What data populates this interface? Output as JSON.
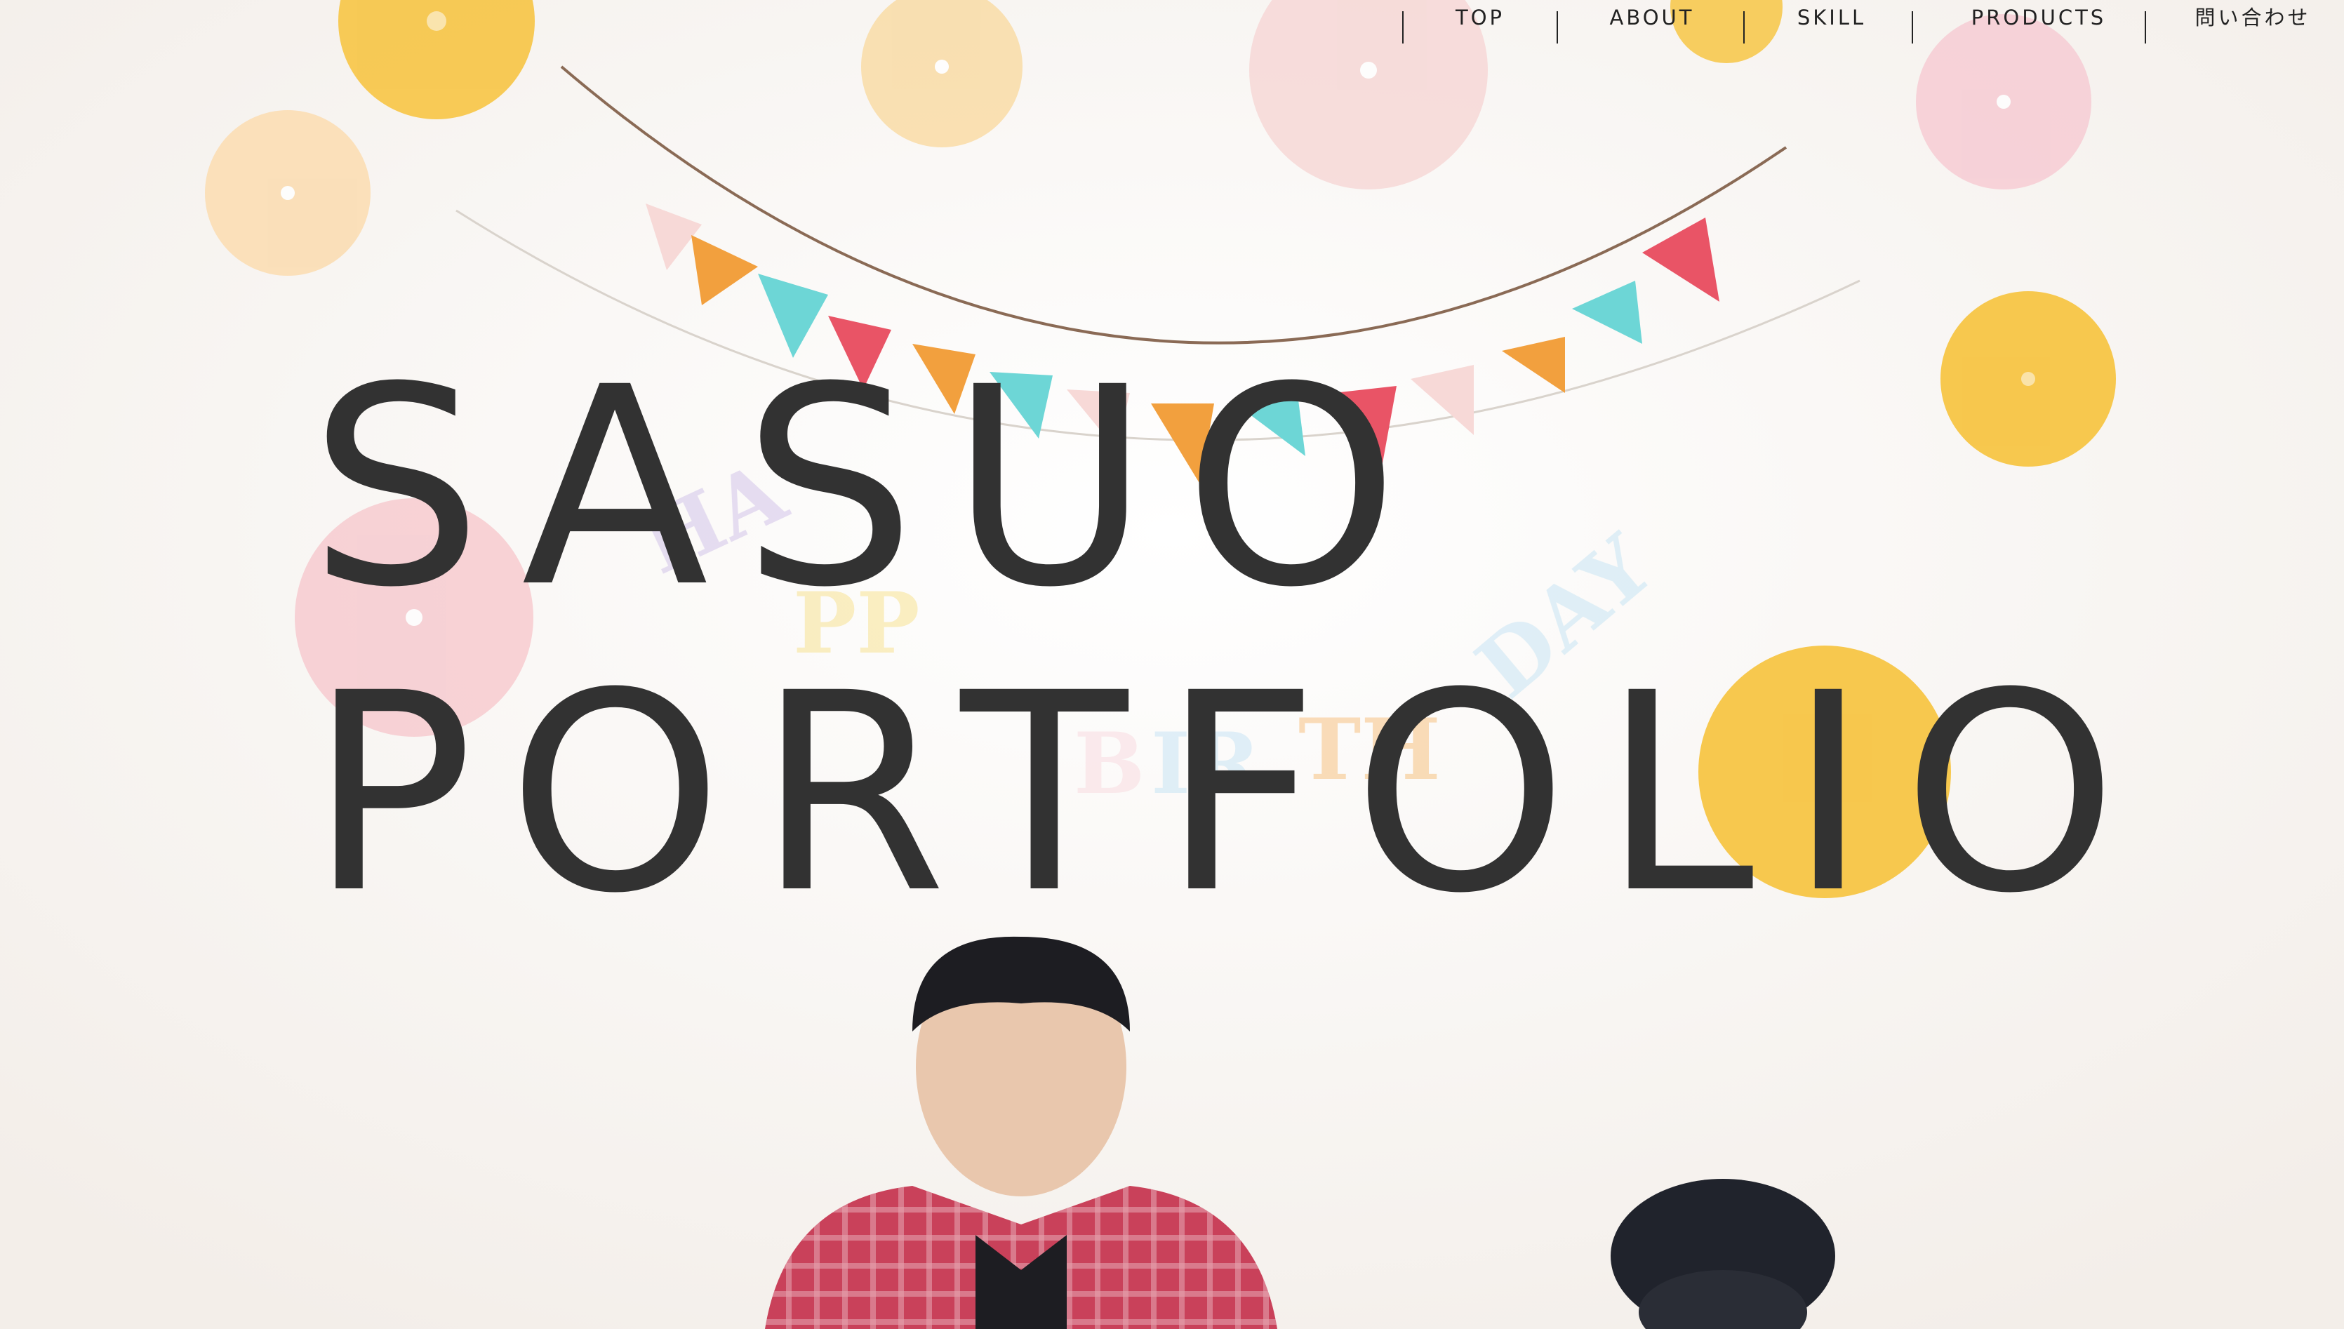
{
  "nav": {
    "items": [
      {
        "label": "TOP"
      },
      {
        "label": "ABOUT"
      },
      {
        "label": "SKILL"
      },
      {
        "label": "PRODUCTS"
      },
      {
        "label": "問い合わせ"
      }
    ]
  },
  "hero": {
    "title_line1": "SASUO",
    "title_line2": "PORTFOLIO",
    "banner_letters": "HAPPY BIRTHDAY"
  },
  "colors": {
    "title": "#323232",
    "nav_text": "#222222",
    "background": "#faf7f4",
    "fan_yellow": "#f7c545",
    "fan_pink": "#f6c9d2",
    "fan_peach": "#f9dca6"
  }
}
